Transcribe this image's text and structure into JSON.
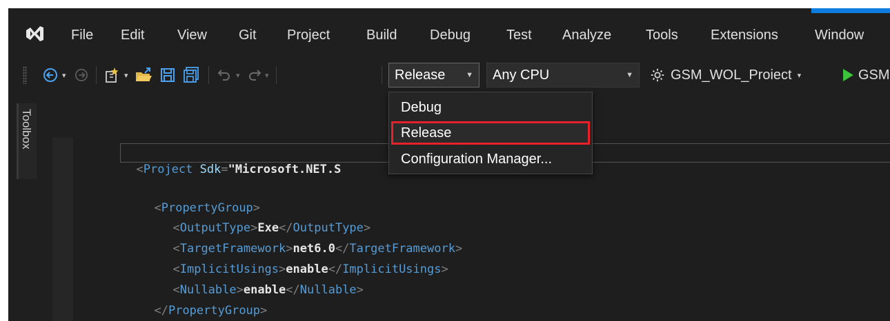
{
  "menu": {
    "items": [
      "File",
      "Edit",
      "View",
      "Git",
      "Project",
      "Build",
      "Debug",
      "Test",
      "Analyze",
      "Tools",
      "Extensions",
      "Window"
    ]
  },
  "toolbar": {
    "configuration_value": "Release",
    "platform_value": "Any CPU",
    "startup_project": "GSM_WOL_Proiect",
    "run_label": "GSM"
  },
  "dropdown": {
    "options": [
      "Debug",
      "Release",
      "Configuration Manager..."
    ],
    "selected_index": 1
  },
  "toolbox": {
    "label": "Toolbox"
  },
  "editor": {
    "project_open": "<",
    "project_tag": "Project",
    "project_attr": "Sdk",
    "project_eq": "=",
    "project_value": "\"Microsoft.NET.S",
    "pg_open": "<",
    "pg_tag": "PropertyGroup",
    "pg_close": ">",
    "output_tag": "OutputType",
    "output_value": "Exe",
    "tf_tag": "TargetFramework",
    "tf_value": "net6.0",
    "iu_tag": "ImplicitUsings",
    "iu_value": "enable",
    "nl_tag": "Nullable",
    "nl_value": "enable",
    "lt": "<",
    "gt": ">",
    "lts": "</"
  },
  "colors": {
    "background": "#1f1f1f",
    "highlight_border": "#e8202a",
    "run_green": "#3cc23c",
    "xml_tag": "#569cd6"
  }
}
